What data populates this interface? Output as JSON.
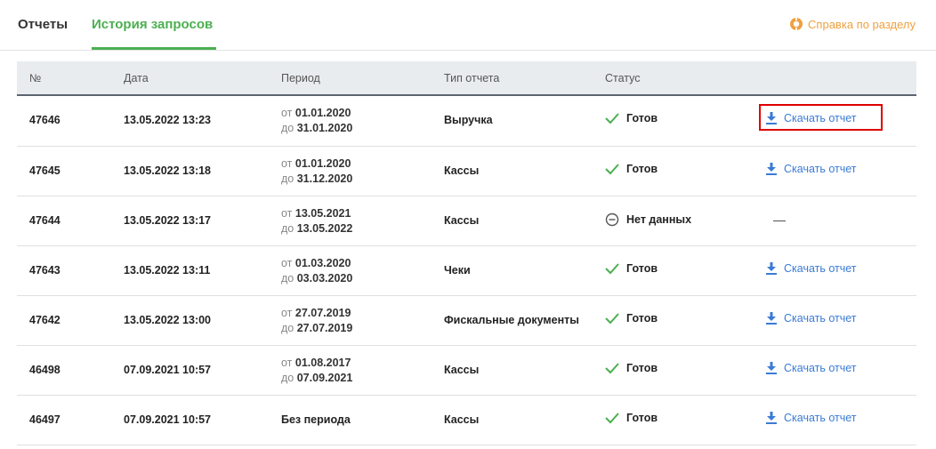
{
  "tabs": {
    "reports": "Отчеты",
    "history": "История запросов"
  },
  "help": "Справка по разделу",
  "columns": {
    "num": "№",
    "date": "Дата",
    "period": "Период",
    "type": "Тип отчета",
    "status": "Статус"
  },
  "rows": [
    {
      "num": "47646",
      "date": "13.05.2022 13:23",
      "from_prefix": "от",
      "from": "01.01.2020",
      "to_prefix": "до",
      "to": "31.01.2020",
      "type": "Выручка",
      "status": "Готов",
      "status_icon": "check-icon",
      "action": "Скачать отчет"
    },
    {
      "num": "47645",
      "date": "13.05.2022 13:18",
      "from_prefix": "от",
      "from": "01.01.2020",
      "to_prefix": "до",
      "to": "31.12.2020",
      "type": "Кассы",
      "status": "Готов",
      "status_icon": "check-icon",
      "action": "Скачать отчет"
    },
    {
      "num": "47644",
      "date": "13.05.2022 13:17",
      "from_prefix": "от",
      "from": "13.05.2021",
      "to_prefix": "до",
      "to": "13.05.2022",
      "type": "Кассы",
      "status": "Нет данных",
      "status_icon": "minus-circle-icon",
      "action": "—"
    },
    {
      "num": "47643",
      "date": "13.05.2022 13:11",
      "from_prefix": "от",
      "from": "01.03.2020",
      "to_prefix": "до",
      "to": "03.03.2020",
      "type": "Чеки",
      "status": "Готов",
      "status_icon": "check-icon",
      "action": "Скачать отчет"
    },
    {
      "num": "47642",
      "date": "13.05.2022 13:00",
      "from_prefix": "от",
      "from": "27.07.2019",
      "to_prefix": "до",
      "to": "27.07.2019",
      "type": "Фискальные документы",
      "status": "Готов",
      "status_icon": "check-icon",
      "action": "Скачать отчет"
    },
    {
      "num": "46498",
      "date": "07.09.2021 10:57",
      "from_prefix": "от",
      "from": "01.08.2017",
      "to_prefix": "до",
      "to": "07.09.2021",
      "type": "Кассы",
      "status": "Готов",
      "status_icon": "check-icon",
      "action": "Скачать отчет"
    },
    {
      "num": "46497",
      "date": "07.09.2021 10:57",
      "period": "Без периода",
      "type": "Кассы",
      "status": "Готов",
      "status_icon": "check-icon",
      "action": "Скачать отчет"
    }
  ],
  "colors": {
    "accent": "#4caf50",
    "link": "#3a7bd5",
    "help": "#f0a040",
    "highlight": "#e00000"
  }
}
